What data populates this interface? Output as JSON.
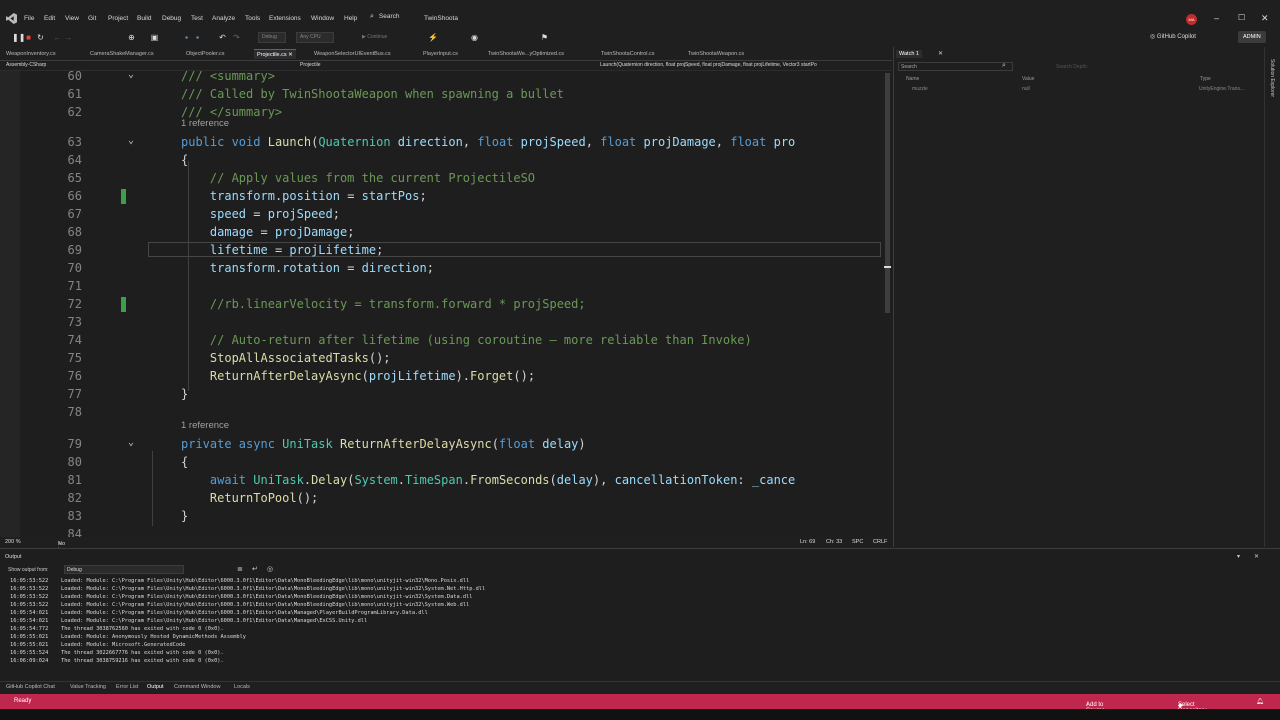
{
  "menu": [
    "File",
    "Edit",
    "View",
    "Git",
    "Project",
    "Build",
    "Debug",
    "Test",
    "Analyze",
    "Tools",
    "Extensions",
    "Window",
    "Help"
  ],
  "search_label": "Search",
  "solution_name": "TwinShoota",
  "avatar_initials": "MA",
  "toolbar": {
    "continue_label": "Continue",
    "config": "Debug",
    "platform": "Any CPU",
    "copilot_label": "GitHub Copilot",
    "admin_label": "ADMIN"
  },
  "tabs": [
    {
      "label": "WeaponInventory.cs",
      "active": false
    },
    {
      "label": "CameraShakeManager.cs",
      "active": false
    },
    {
      "label": "ObjectPooler.cs",
      "active": false
    },
    {
      "label": "Projectile.cs",
      "active": true
    },
    {
      "label": "WeaponSelectorUIEventBus.cs",
      "active": false
    },
    {
      "label": "PlayerInput.cs",
      "active": false
    },
    {
      "label": "TwinShootaWe...yOptimized.cs",
      "active": false
    },
    {
      "label": "TwinShootaControl.cs",
      "active": false
    },
    {
      "label": "TwinShootaWeapon.cs",
      "active": false
    }
  ],
  "navbar": {
    "project": "Assembly-CSharp",
    "class": "Projectile",
    "member": "Launch(Quaternion direction, float projSpeed, float projDamage, float projLifetime, Vector3 startPo"
  },
  "code_lines": [
    {
      "n": "60",
      "html": "<span class=\"cm\">/// &lt;summary&gt;</span>",
      "fold": true
    },
    {
      "n": "61",
      "html": "<span class=\"cm\">/// Called by TwinShootaWeapon when spawning a bullet</span>"
    },
    {
      "n": "62",
      "html": "<span class=\"cm\">/// &lt;/summary&gt;</span>"
    },
    {
      "n": "63",
      "html": "<span class=\"kw\">public void</span> <span class=\"fn\">Launch</span><span class=\"pu\">(</span><span class=\"ty\">Quaternion</span> <span class=\"pa\">direction</span><span class=\"pu\">,</span> <span class=\"kw\">float</span> <span class=\"pa\">projSpeed</span><span class=\"pu\">,</span> <span class=\"kw\">float</span> <span class=\"pa\">projDamage</span><span class=\"pu\">,</span> <span class=\"kw\">float</span> <span class=\"pa\">pro</span>",
      "fold": true,
      "ref": "1 reference"
    },
    {
      "n": "64",
      "html": "<span class=\"pu\">{</span>"
    },
    {
      "n": "65",
      "html": "    <span class=\"cm\">// Apply values from the current ProjectileSO</span>"
    },
    {
      "n": "66",
      "html": "    <span class=\"va\">transform</span><span class=\"pu\">.</span><span class=\"va\">position</span> <span class=\"pu\">=</span> <span class=\"va\">startPos</span><span class=\"pu\">;</span>",
      "mark": true
    },
    {
      "n": "67",
      "html": "    <span class=\"va\">speed</span> <span class=\"pu\">=</span> <span class=\"pa\">projSpeed</span><span class=\"pu\">;</span>"
    },
    {
      "n": "68",
      "html": "    <span class=\"va\">damage</span> <span class=\"pu\">=</span> <span class=\"pa\">projDamage</span><span class=\"pu\">;</span>"
    },
    {
      "n": "69",
      "html": "    <span class=\"va\">lifetime</span> <span class=\"pu\">=</span> <span class=\"pa\">projLifetime</span><span class=\"pu\">;</span>",
      "current": true
    },
    {
      "n": "70",
      "html": "    <span class=\"va\">transform</span><span class=\"pu\">.</span><span class=\"va\">rotation</span> <span class=\"pu\">=</span> <span class=\"pa\">direction</span><span class=\"pu\">;</span>"
    },
    {
      "n": "71",
      "html": ""
    },
    {
      "n": "72",
      "html": "    <span class=\"cm\">//rb.linearVelocity = transform.forward * projSpeed;</span>",
      "mark": true
    },
    {
      "n": "73",
      "html": ""
    },
    {
      "n": "74",
      "html": "    <span class=\"cm\">// Auto-return after lifetime (using coroutine — more reliable than Invoke)</span>"
    },
    {
      "n": "75",
      "html": "    <span class=\"fn\">StopAllAssociatedTasks</span><span class=\"pu\">();</span>"
    },
    {
      "n": "76",
      "html": "    <span class=\"fn\">ReturnAfterDelayAsync</span><span class=\"pu\">(</span><span class=\"va\">projLifetime</span><span class=\"pu\">).</span><span class=\"fn\">Forget</span><span class=\"pu\">();</span>"
    },
    {
      "n": "77",
      "html": "<span class=\"pu\">}</span>"
    },
    {
      "n": "78",
      "html": ""
    },
    {
      "n": "79",
      "html": "<span class=\"kw\">private async</span> <span class=\"ty\">UniTask</span> <span class=\"fn\">ReturnAfterDelayAsync</span><span class=\"pu\">(</span><span class=\"kw\">float</span> <span class=\"pa\">delay</span><span class=\"pu\">)</span>",
      "fold": true,
      "ref": "1 reference"
    },
    {
      "n": "80",
      "html": "<span class=\"pu\">{</span>"
    },
    {
      "n": "81",
      "html": "    <span class=\"kw\">await</span> <span class=\"ty\">UniTask</span><span class=\"pu\">.</span><span class=\"fn\">Delay</span><span class=\"pu\">(</span><span class=\"ty\">System</span><span class=\"pu\">.</span><span class=\"ty\">TimeSpan</span><span class=\"pu\">.</span><span class=\"fn\">FromSeconds</span><span class=\"pu\">(</span><span class=\"pa\">delay</span><span class=\"pu\">),</span> <span class=\"va\">cancellationToken</span><span class=\"pu\">:</span> <span class=\"va\">_cance</span>"
    },
    {
      "n": "82",
      "html": "    <span class=\"fn\">ReturnToPool</span><span class=\"pu\">();</span>"
    },
    {
      "n": "83",
      "html": "<span class=\"pu\">}</span>"
    },
    {
      "n": "84",
      "html": ""
    }
  ],
  "editor_status": {
    "zoom": "200 %",
    "issues": "No issues found",
    "line": "Ln: 69",
    "col": "Ch: 33",
    "spc": "SPC",
    "crlf": "CRLF"
  },
  "watch": {
    "title": "Watch 1",
    "search_placeholder": "Search",
    "search_depth": "Search Depth:",
    "col_name": "Name",
    "col_value": "Value",
    "col_type": "Type",
    "row_name": "muzzle",
    "row_value": "null",
    "row_type": "UnityEngine.Trans..."
  },
  "right_strip_label": "Solution Explorer",
  "output": {
    "title": "Output",
    "show_from_label": "Show output from:",
    "show_from_value": "Debug",
    "lines": [
      "16:05:53:522    Loaded: Module: C:\\Program Files\\Unity\\Hub\\Editor\\6000.3.0f1\\Editor\\Data\\MonoBleedingEdge\\lib\\mono\\unityjit-win32\\Mono.Posix.dll",
      "16:05:53:522    Loaded: Module: C:\\Program Files\\Unity\\Hub\\Editor\\6000.3.0f1\\Editor\\Data\\MonoBleedingEdge\\lib\\mono\\unityjit-win32\\System.Net.Http.dll",
      "16:05:53:522    Loaded: Module: C:\\Program Files\\Unity\\Hub\\Editor\\6000.3.0f1\\Editor\\Data\\MonoBleedingEdge\\lib\\mono\\unityjit-win32\\System.Data.dll",
      "16:05:53:522    Loaded: Module: C:\\Program Files\\Unity\\Hub\\Editor\\6000.3.0f1\\Editor\\Data\\MonoBleedingEdge\\lib\\mono\\unityjit-win32\\System.Web.dll",
      "16:05:54:021    Loaded: Module: C:\\Program Files\\Unity\\Hub\\Editor\\6000.3.0f1\\Editor\\Data\\Managed\\PlayerBuildProgramLibrary.Data.dll",
      "16:05:54:021    Loaded: Module: C:\\Program Files\\Unity\\Hub\\Editor\\6000.3.0f1\\Editor\\Data\\Managed\\ExCSS.Unity.dll",
      "16:05:54:772    The thread 3038762560 has exited with code 0 (0x0).",
      "16:05:55:021    Loaded: Module: Anonymously Hosted DynamicMethods Assembly",
      "16:05:55:021    Loaded: Module: Microsoft.GeneratedCode",
      "16:05:55:524    The thread 3022667776 has exited with code 0 (0x0).",
      "16:06:09:024    The thread 3038759216 has exited with code 0 (0x0)."
    ]
  },
  "bottom_tabs": [
    {
      "label": "GitHub Copilot Chat",
      "active": false
    },
    {
      "label": "Value Tracking",
      "active": false
    },
    {
      "label": "Error List",
      "active": false
    },
    {
      "label": "Output",
      "active": true
    },
    {
      "label": "Command Window",
      "active": false
    },
    {
      "label": "Locals",
      "active": false
    }
  ],
  "status": {
    "ready": "Ready",
    "source_control": "Add to Source Control",
    "repository": "Select Repository"
  },
  "colors": {
    "accent": "#c0274e",
    "editor_bg": "#1e1e1e",
    "chrome_bg": "#1f1f1f"
  }
}
